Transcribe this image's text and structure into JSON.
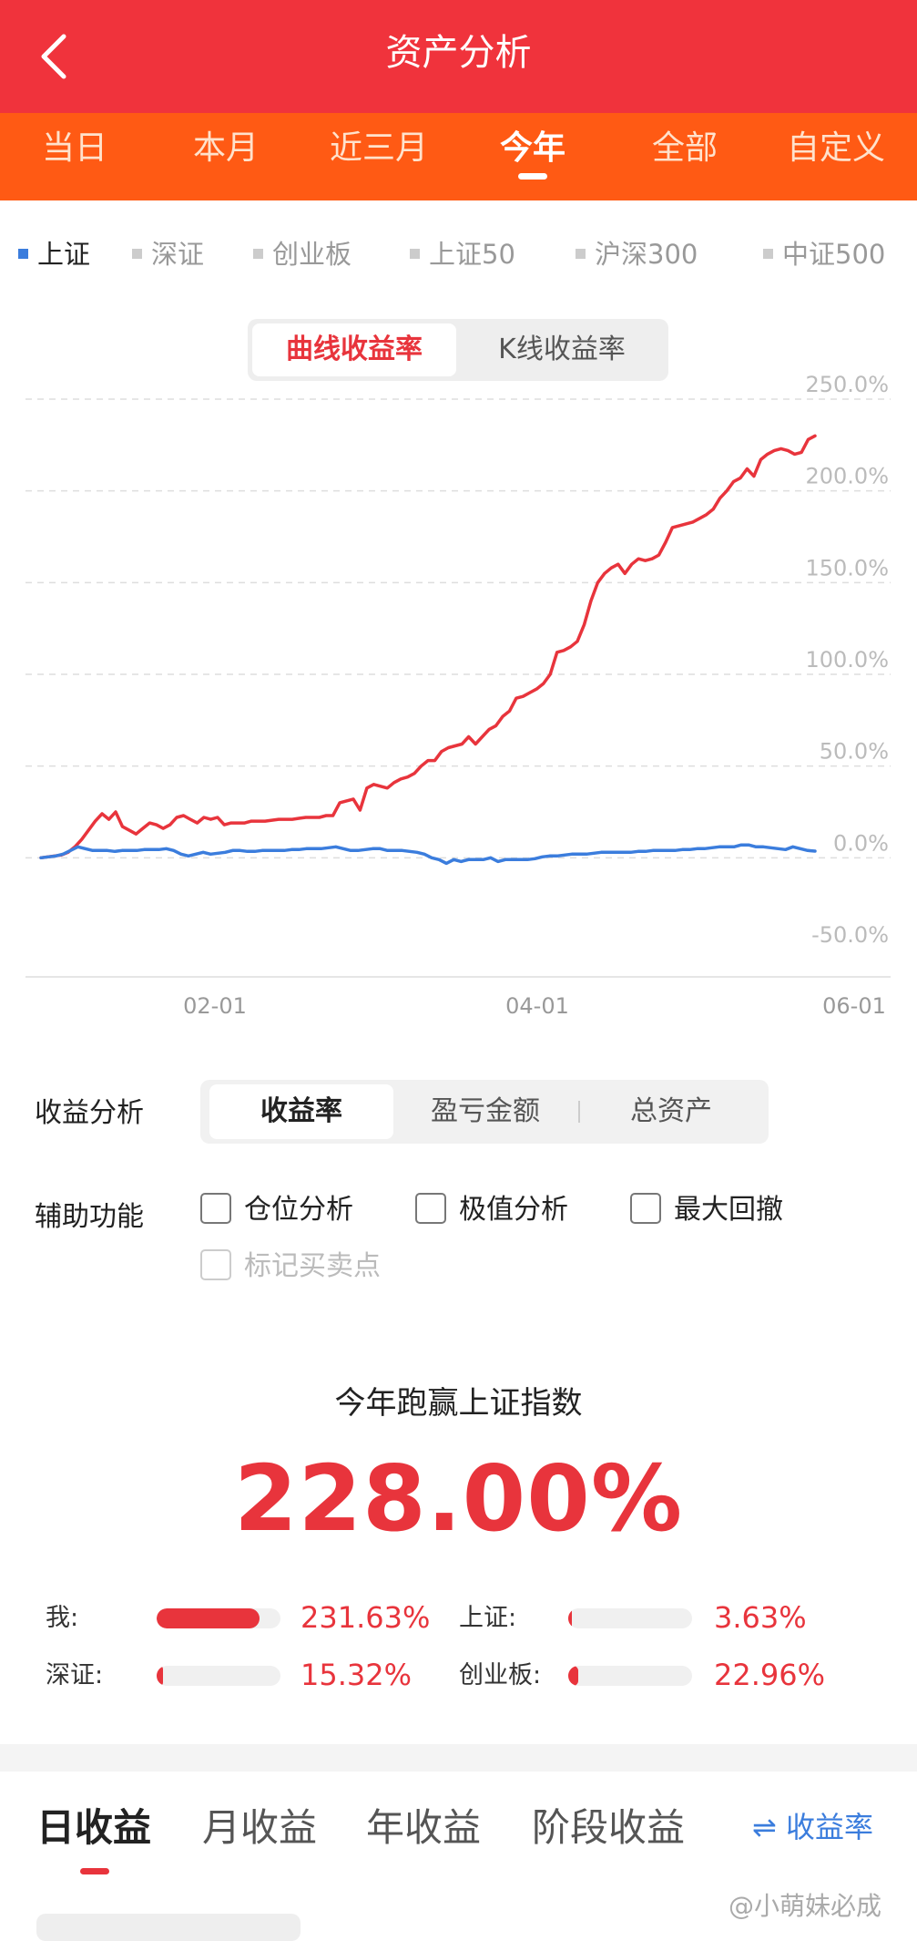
{
  "header": {
    "title": "资产分析"
  },
  "tabs": [
    {
      "label": "当日"
    },
    {
      "label": "本月"
    },
    {
      "label": "近三月"
    },
    {
      "label": "今年",
      "active": true
    },
    {
      "label": "全部"
    },
    {
      "label": "自定义"
    }
  ],
  "indices": [
    {
      "label": "上证",
      "active": true
    },
    {
      "label": "深证"
    },
    {
      "label": "创业板"
    },
    {
      "label": "上证50"
    },
    {
      "label": "沪深300"
    },
    {
      "label": "中证500"
    }
  ],
  "chart_mode": {
    "options": [
      "曲线收益率",
      "K线收益率"
    ],
    "selected": "曲线收益率"
  },
  "chart_data": {
    "type": "line",
    "ylim": [
      -50,
      250
    ],
    "yticks": [
      "250.0%",
      "200.0%",
      "150.0%",
      "100.0%",
      "50.0%",
      "0.0%",
      "-50.0%"
    ],
    "xticks": [
      "02-01",
      "04-01",
      "06-01"
    ],
    "grid": true,
    "series": [
      {
        "color": "#e8343c",
        "values": [
          0,
          0.5,
          1,
          1.5,
          3,
          6,
          10,
          15,
          20,
          24,
          21,
          25,
          17,
          15,
          13,
          16,
          19,
          18,
          16,
          18,
          22,
          23,
          21,
          19,
          22,
          21,
          22,
          18,
          19,
          19,
          19,
          20,
          20,
          20,
          20.5,
          21,
          21,
          21,
          21.5,
          22,
          22,
          22,
          23,
          23,
          30,
          31,
          32,
          26,
          38,
          40,
          39,
          38,
          41,
          43,
          44,
          46,
          50,
          53,
          53,
          58,
          60,
          61,
          62,
          66,
          62,
          66,
          70,
          72,
          77,
          80,
          87,
          88,
          90,
          92,
          95,
          100,
          112,
          113,
          115,
          118,
          127,
          140,
          150,
          155,
          158,
          160,
          155,
          160,
          163,
          162,
          163,
          165,
          172,
          180,
          181,
          182,
          183,
          185,
          187,
          190,
          196,
          200,
          205,
          207,
          212,
          208,
          217,
          220,
          222,
          223,
          222,
          220,
          221,
          228,
          230
        ]
      },
      {
        "color": "#3b7ddd",
        "values": [
          0,
          0.5,
          1,
          2,
          4,
          6,
          5,
          4,
          4,
          4,
          3.5,
          4,
          4,
          4,
          4.5,
          4.5,
          4.5,
          5,
          4,
          2,
          1,
          2,
          3,
          2,
          2.5,
          3,
          4,
          4,
          3.5,
          3.5,
          4,
          4,
          4,
          4,
          4.5,
          4.5,
          5,
          5,
          5,
          5.5,
          6,
          5,
          4,
          4,
          4.5,
          5,
          5,
          4,
          4,
          4,
          3.5,
          3,
          2,
          0,
          -1,
          -3,
          -1,
          -2,
          -1,
          -1,
          -1,
          0,
          -2,
          -1,
          -1,
          -1,
          -1,
          -0.5,
          0.5,
          1,
          1,
          1.5,
          2,
          2,
          2,
          2.5,
          3,
          3,
          3,
          3,
          3,
          3.5,
          3.5,
          4,
          4,
          4,
          4,
          4.5,
          4.5,
          5,
          5,
          5.5,
          6,
          6,
          6,
          7,
          7,
          6,
          6,
          5.5,
          5,
          4.5,
          6,
          5,
          4,
          3.63
        ]
      }
    ]
  },
  "analysis": {
    "label": "收益分析",
    "options": [
      "收益率",
      "盈亏金额",
      "总资产"
    ],
    "selected": "收益率"
  },
  "aux": {
    "label": "辅助功能",
    "options": [
      {
        "label": "仓位分析"
      },
      {
        "label": "极值分析"
      },
      {
        "label": "最大回撤"
      },
      {
        "label": "标记买卖点",
        "disabled": true
      }
    ]
  },
  "beat": {
    "title": "今年跑赢上证指数",
    "value": "228.00%"
  },
  "compare": [
    {
      "label": "我:",
      "value": "231.63%",
      "fraction": 0.83
    },
    {
      "label": "上证:",
      "value": "3.63%",
      "fraction": 0.03
    },
    {
      "label": "深证:",
      "value": "15.32%",
      "fraction": 0.05
    },
    {
      "label": "创业板:",
      "value": "22.96%",
      "fraction": 0.08
    }
  ],
  "bottom_tabs": [
    {
      "label": "日收益",
      "active": true
    },
    {
      "label": "月收益"
    },
    {
      "label": "年收益"
    },
    {
      "label": "阶段收益"
    }
  ],
  "toggle": {
    "icon": "swap-icon",
    "label": "收益率"
  },
  "watermark": "@小萌妹必成"
}
